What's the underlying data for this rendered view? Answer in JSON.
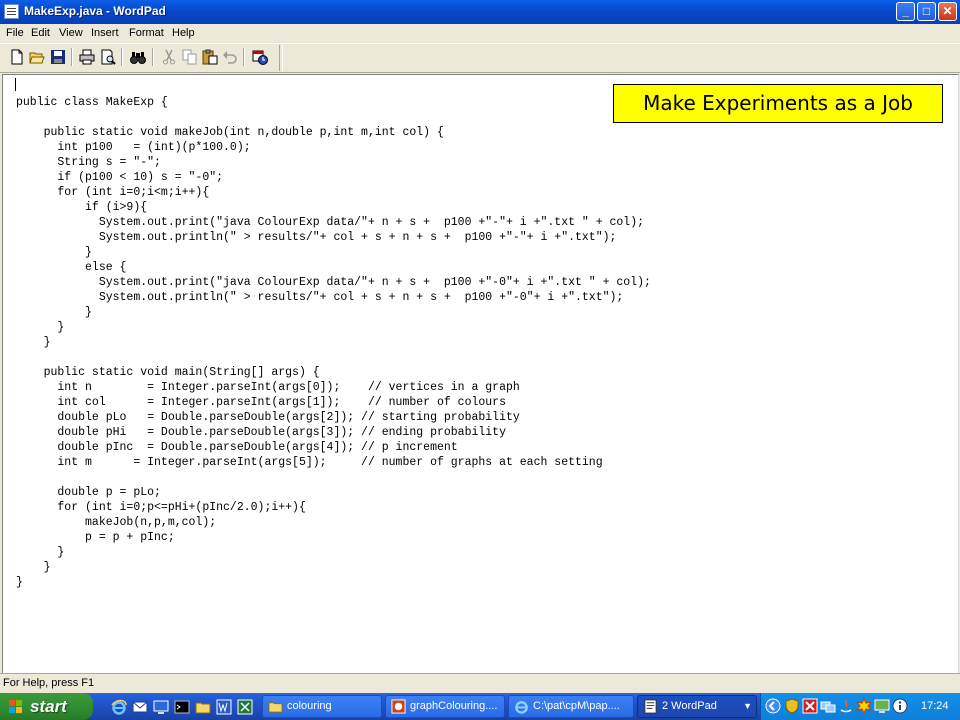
{
  "window": {
    "title": "MakeExp.java - WordPad",
    "buttons": {
      "minimize": "_",
      "maximize": "□",
      "close": "✕"
    }
  },
  "menu": [
    "File",
    "Edit",
    "View",
    "Insert",
    "Format",
    "Help"
  ],
  "toolbar": {
    "icons": [
      "new-document-icon",
      "open-folder-icon",
      "save-icon",
      "print-icon",
      "print-preview-icon",
      "find-icon",
      "cut-icon",
      "copy-icon",
      "paste-icon",
      "undo-icon",
      "date-time-icon"
    ]
  },
  "document": {
    "lines": [
      "public class MakeExp {",
      "",
      "    public static void makeJob(int n,double p,int m,int col) {",
      "      int p100   = (int)(p*100.0);",
      "      String s = \"-\";",
      "      if (p100 < 10) s = \"-0\";",
      "      for (int i=0;i<m;i++){",
      "          if (i>9){",
      "            System.out.print(\"java ColourExp data/\"+ n + s +  p100 +\"-\"+ i +\".txt \" + col);",
      "            System.out.println(\" > results/\"+ col + s + n + s +  p100 +\"-\"+ i +\".txt\");",
      "          }",
      "          else {",
      "            System.out.print(\"java ColourExp data/\"+ n + s +  p100 +\"-0\"+ i +\".txt \" + col);",
      "            System.out.println(\" > results/\"+ col + s + n + s +  p100 +\"-0\"+ i +\".txt\");",
      "          }",
      "      }",
      "    }",
      "",
      "    public static void main(String[] args) {",
      "      int n        = Integer.parseInt(args[0]);    // vertices in a graph",
      "      int col      = Integer.parseInt(args[1]);    // number of colours",
      "      double pLo   = Double.parseDouble(args[2]); // starting probability",
      "      double pHi   = Double.parseDouble(args[3]); // ending probability",
      "      double pInc  = Double.parseDouble(args[4]); // p increment",
      "      int m      = Integer.parseInt(args[5]);     // number of graphs at each setting",
      "",
      "      double p = pLo;",
      "      for (int i=0;p<=pHi+(pInc/2.0);i++){",
      "          makeJob(n,p,m,col);",
      "          p = p + pInc;",
      "      }",
      "    }",
      "}"
    ]
  },
  "callout": "Make Experiments as a Job",
  "status": "For Help, press F1",
  "taskbar": {
    "start": "start",
    "tasks": [
      {
        "label": "colouring",
        "icon": "folder-icon",
        "active": false
      },
      {
        "label": "graphColouring....",
        "icon": "powerpoint-icon",
        "active": false
      },
      {
        "label": "C:\\pat\\cpM\\pap....",
        "icon": "internet-explorer-icon",
        "active": false
      },
      {
        "label": "2 WordPad",
        "icon": "wordpad-icon",
        "active": true
      }
    ],
    "clock": "17:24"
  }
}
